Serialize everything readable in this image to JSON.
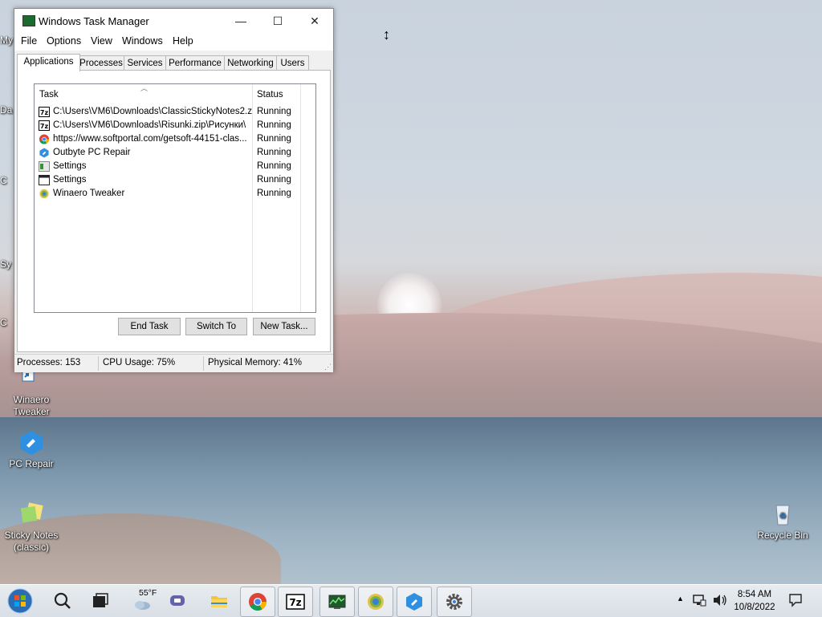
{
  "desktop": {
    "edge_labels": [
      "My",
      "Da",
      "C",
      "Sy",
      "C"
    ],
    "icons": [
      {
        "label_line1": "Winaero",
        "label_line2": "Tweaker"
      },
      {
        "label_line1": "PC Repair",
        "label_line2": ""
      },
      {
        "label_line1": "Sticky Notes",
        "label_line2": "(classic)"
      },
      {
        "label_line1": "Recycle Bin",
        "label_line2": ""
      }
    ]
  },
  "window": {
    "title": "Windows Task Manager",
    "controls": {
      "minimize": "—",
      "maximize": "☐",
      "close": "✕"
    },
    "menu": [
      "File",
      "Options",
      "View",
      "Windows",
      "Help"
    ],
    "tabs": [
      "Applications",
      "Processes",
      "Services",
      "Performance",
      "Networking",
      "Users"
    ],
    "active_tab": "Applications",
    "columns": {
      "task": "Task",
      "status": "Status"
    },
    "tasks": [
      {
        "task": "C:\\Users\\VM6\\Downloads\\ClassicStickyNotes2.zip\\",
        "status": "Running",
        "icon": "7zip-icon"
      },
      {
        "task": "C:\\Users\\VM6\\Downloads\\Risunki.zip\\Рисунки\\",
        "status": "Running",
        "icon": "7zip-icon"
      },
      {
        "task": "https://www.softportal.com/getsoft-44151-clas...",
        "status": "Running",
        "icon": "chrome-icon"
      },
      {
        "task": "Outbyte PC Repair",
        "status": "Running",
        "icon": "outbyte-icon"
      },
      {
        "task": "Settings",
        "status": "Running",
        "icon": "settings-icon"
      },
      {
        "task": "Settings",
        "status": "Running",
        "icon": "window-icon"
      },
      {
        "task": "Winaero Tweaker",
        "status": "Running",
        "icon": "winaero-icon"
      }
    ],
    "buttons": {
      "end_task": "End Task",
      "switch_to": "Switch To",
      "new_task": "New Task..."
    },
    "statusbar": {
      "processes": "Processes: 153",
      "cpu": "CPU Usage: 75%",
      "memory": "Physical Memory: 41%"
    }
  },
  "taskbar": {
    "weather": "55°F",
    "items": [
      "start-orb-icon",
      "search-icon",
      "task-view-icon",
      "weather-icon",
      "teams-icon",
      "file-explorer-icon",
      "chrome-icon",
      "7zip-icon",
      "task-manager-icon",
      "winaero-icon",
      "outbyte-icon",
      "settings-icon"
    ],
    "tray": {
      "chevron": "▲"
    },
    "clock": {
      "time": "8:54 AM",
      "date": "10/8/2022"
    }
  }
}
